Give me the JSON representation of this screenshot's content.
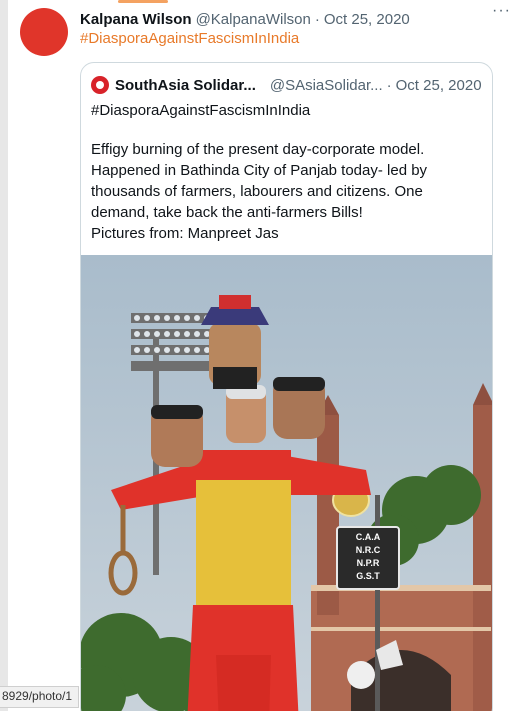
{
  "tweet": {
    "author_name": "Kalpana Wilson",
    "author_handle": "@KalpanaWilson",
    "separator": "·",
    "date": "Oct 25, 2020",
    "hashtag": "#DiasporaAgainstFascismInIndia",
    "more_label": "···"
  },
  "quoted": {
    "author_name": "SouthAsia Solidar...",
    "author_handle": "@SAsiaSolidar...",
    "separator": "·",
    "date": "Oct 25, 2020",
    "hashtag": "#DiasporaAgainstFascismInIndia",
    "text_lines": [
      "Effigy burning of the present day-corporate model.",
      "Happened in Bathinda City of Panjab today- led by",
      "thousands of farmers, labourers and citizens. One",
      "demand, take back the anti-farmers Bills!",
      "Pictures from: Manpreet Jas"
    ],
    "sign_lines": [
      "C.A.A",
      "N.R.C",
      "N.P.R",
      "G.S.T"
    ]
  },
  "status_bar": {
    "url_fragment": "8929/photo/1"
  },
  "colors": {
    "avatar": "#e0352a",
    "hashtag": "#e87a2a",
    "effigy_red": "#e0322a",
    "effigy_gold": "#e6c03a",
    "sky": "#b7c8d6"
  }
}
